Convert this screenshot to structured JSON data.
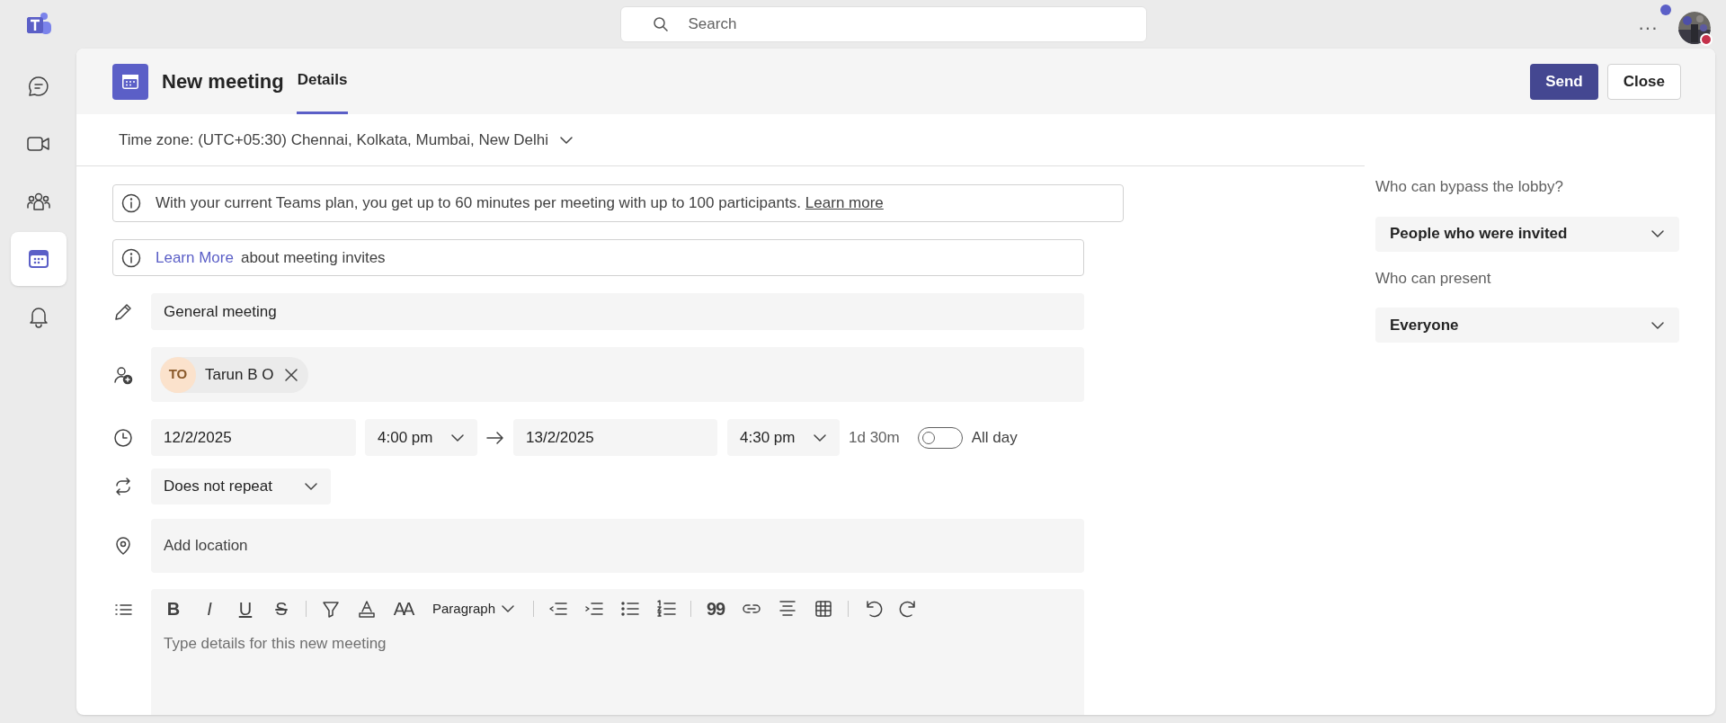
{
  "top_bar": {
    "search_placeholder": "Search",
    "more": "···"
  },
  "rail": [
    {
      "kind": "chat",
      "selected": false
    },
    {
      "kind": "video",
      "selected": false
    },
    {
      "kind": "people",
      "selected": false
    },
    {
      "kind": "calendar",
      "selected": true
    },
    {
      "kind": "bell",
      "selected": false
    }
  ],
  "header": {
    "title": "New meeting",
    "tabs": [
      {
        "label": "Details",
        "selected": true
      }
    ],
    "buttons": [
      {
        "label": "Send",
        "kind": "primary"
      },
      {
        "label": "Close",
        "kind": "secondary"
      }
    ]
  },
  "time_zone": "Time zone: (UTC+05:30) Chennai, Kolkata, Mumbai, New Delhi",
  "notices": [
    {
      "text": "With your current Teams plan, you get up to 60 minutes per meeting with up to 100 participants.",
      "link": "Learn more",
      "link_first": false
    },
    {
      "text": "about meeting invites",
      "link": "Learn More",
      "link_first": true
    }
  ],
  "title_field": {
    "value": "General meeting"
  },
  "attendees": [
    {
      "initials": "TO",
      "name": "Tarun B O"
    }
  ],
  "schedule": {
    "start_date": "12/2/2025",
    "start_time": "4:00 pm",
    "end_date": "13/2/2025",
    "end_time": "4:30 pm",
    "duration": "1d 30m",
    "all_day": {
      "label": "All day",
      "on": false
    }
  },
  "repeat": "Does not repeat",
  "location": {
    "placeholder": "Add location"
  },
  "editor": {
    "toolbar": [
      {
        "kind": "bold",
        "glyph": "B"
      },
      {
        "kind": "italic",
        "glyph": "I"
      },
      {
        "kind": "underline",
        "glyph": "U"
      },
      {
        "kind": "strike",
        "glyph": "S"
      },
      {
        "kind": "sep"
      },
      {
        "kind": "highlight"
      },
      {
        "kind": "font-color"
      },
      {
        "kind": "font-size",
        "glyph": "AA"
      },
      {
        "kind": "style",
        "label": "Paragraph"
      },
      {
        "kind": "sep"
      },
      {
        "kind": "outdent"
      },
      {
        "kind": "indent"
      },
      {
        "kind": "bullets"
      },
      {
        "kind": "numbering"
      },
      {
        "kind": "sep"
      },
      {
        "kind": "quote",
        "glyph": "99"
      },
      {
        "kind": "link"
      },
      {
        "kind": "align"
      },
      {
        "kind": "table"
      },
      {
        "kind": "sep"
      },
      {
        "kind": "undo"
      },
      {
        "kind": "redo"
      }
    ],
    "placeholder": "Type details for this new meeting"
  },
  "options": [
    {
      "label": "Who can bypass the lobby?",
      "value": "People who were invited"
    },
    {
      "label": "Who can present",
      "value": "Everyone"
    }
  ]
}
